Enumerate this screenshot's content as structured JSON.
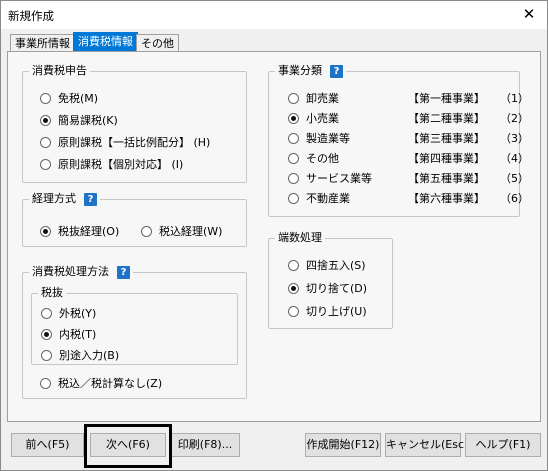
{
  "window": {
    "title": "新規作成",
    "close_glyph": "✕"
  },
  "tabs": [
    "事業所情報",
    "消費税情報",
    "その他"
  ],
  "tax_filing": {
    "title": "消費税申告",
    "options": [
      "免税(M)",
      "簡易課税(K)",
      "原則課税【一括比例配分】 (H)",
      "原則課税【個別対応】 (I)"
    ],
    "selected": 1
  },
  "accounting": {
    "title": "経理方式",
    "options": [
      "税抜経理(O)",
      "税込経理(W)"
    ],
    "selected": 0
  },
  "tax_method": {
    "title": "消費税処理方法",
    "sub_title": "税抜",
    "sub_options": [
      "外税(Y)",
      "内税(T)",
      "別途入力(B)"
    ],
    "selected": 1,
    "other_option": "税込／税計算なし(Z)"
  },
  "business_type": {
    "title": "事業分類",
    "options": [
      {
        "label": "卸売業",
        "kind": "【第一種事業】",
        "num": "（1）"
      },
      {
        "label": "小売業",
        "kind": "【第二種事業】",
        "num": "（2）"
      },
      {
        "label": "製造業等",
        "kind": "【第三種事業】",
        "num": "（3）"
      },
      {
        "label": "その他",
        "kind": "【第四種事業】",
        "num": "（4）"
      },
      {
        "label": "サービス業等",
        "kind": "【第五種事業】",
        "num": "（5）"
      },
      {
        "label": "不動産業",
        "kind": "【第六種事業】",
        "num": "（6）"
      }
    ],
    "selected": 1
  },
  "rounding": {
    "title": "端数処理",
    "options": [
      "四捨五入(S)",
      "切り捨て(D)",
      "切り上げ(U)"
    ],
    "selected": 1
  },
  "help_glyph": "?",
  "buttons": {
    "prev": "前へ(F5)",
    "next": "次へ(F6)",
    "print": "印刷(F8)...",
    "create": "作成開始(F12)",
    "cancel": "キャンセル(Esc)",
    "help": "ヘルプ(F1)"
  },
  "colors": {
    "accent": "#0078d7",
    "help_icon": "#1e73c8",
    "panel": "#f7f7f7",
    "window": "#f0f0f0"
  }
}
